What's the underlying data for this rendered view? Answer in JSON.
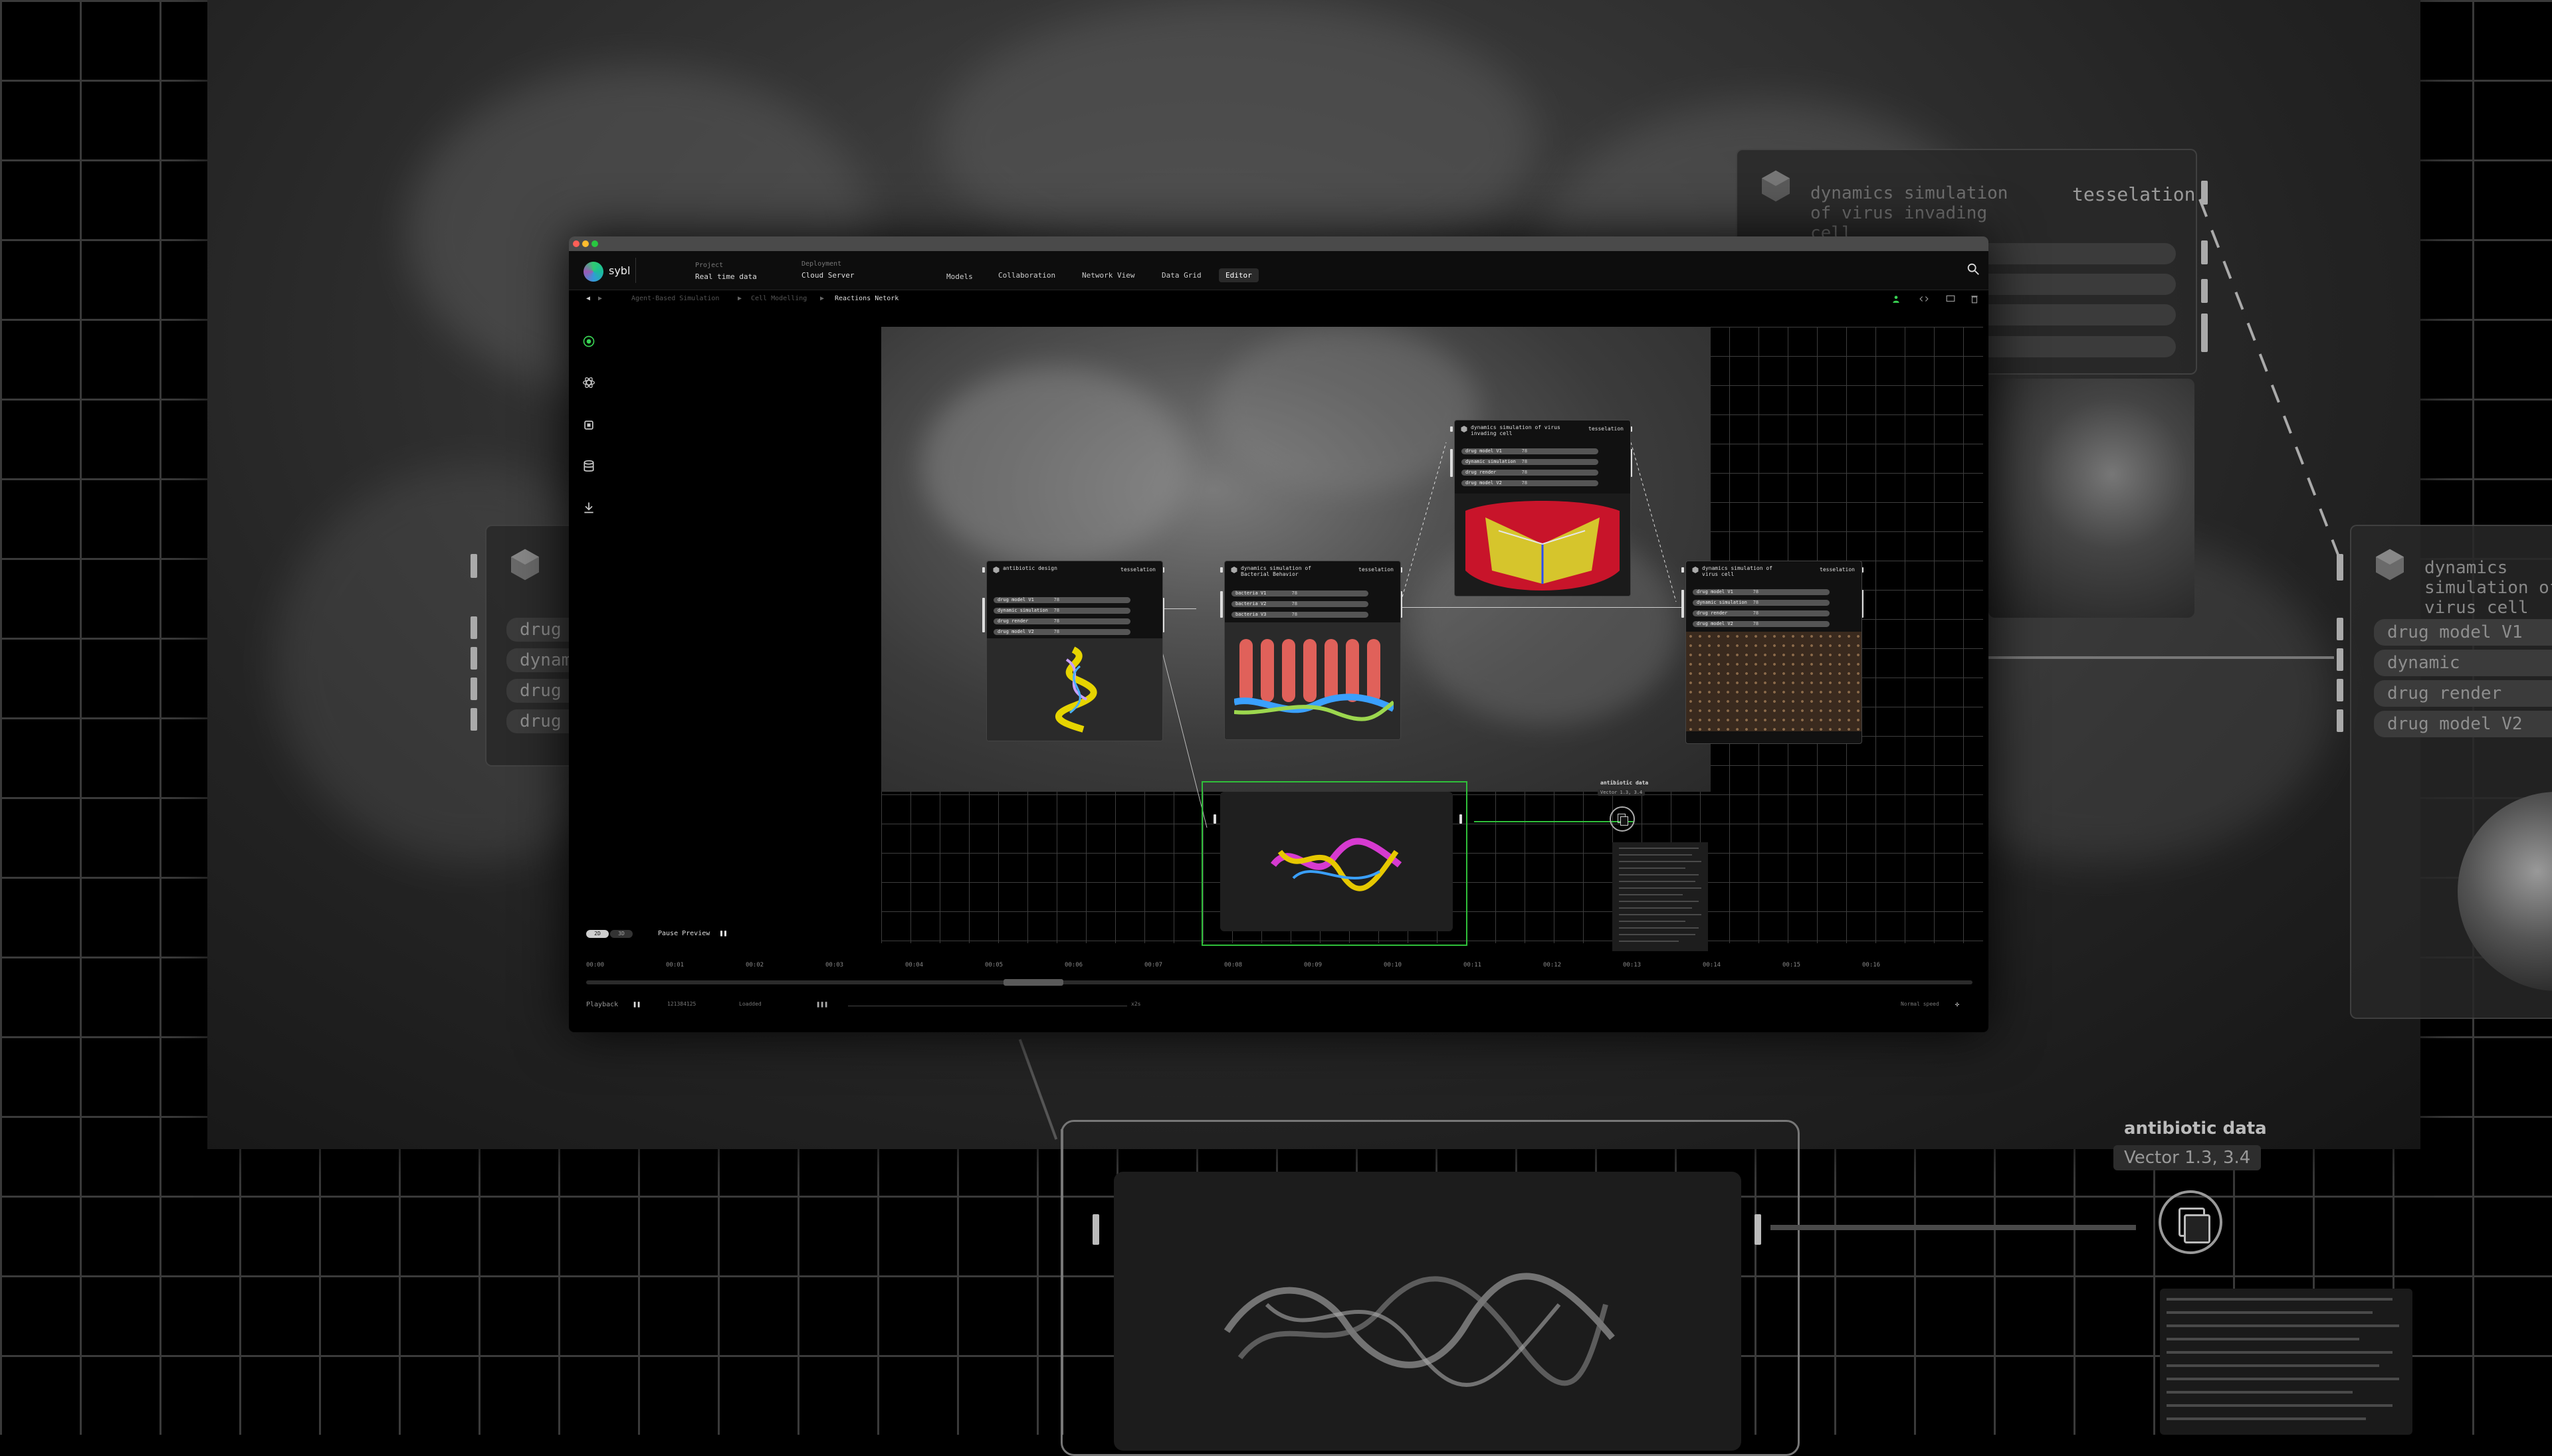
{
  "window": {
    "brand": "sybl",
    "project_key": "Project",
    "project_value": "Real time data",
    "deployment_key": "Deployment",
    "deployment_value": "Cloud Server",
    "nav": [
      "Models",
      "Collaboration",
      "Network View",
      "Data Grid",
      "Editor"
    ],
    "active_nav": "Editor"
  },
  "breadcrumb": [
    "Agent-Based Simulation",
    "Cell Modelling",
    "Reactions Netork"
  ],
  "sidebar_icons": [
    "target-icon",
    "atom-icon",
    "chip-icon",
    "database-icon",
    "download-icon"
  ],
  "nodes": {
    "antibiotic": {
      "title": "antibiotic design",
      "tag": "tesselation",
      "rows": [
        {
          "label": "drug model V1",
          "pct": "78"
        },
        {
          "label": "dynamic simulation",
          "pct": "78"
        },
        {
          "label": "drug render",
          "pct": "78"
        },
        {
          "label": "drug model V2",
          "pct": "78"
        }
      ]
    },
    "bacterial": {
      "title": "dynamics simulation of Bacterial Behavior",
      "tag": "tesselation",
      "rows": [
        {
          "label": "bacteria V1",
          "pct": "78"
        },
        {
          "label": "bacteria V2",
          "pct": "78"
        },
        {
          "label": "bacteria V3",
          "pct": "78"
        }
      ]
    },
    "virus_invading": {
      "title": "dynamics simulation of virus invading cell",
      "tag": "tesselation",
      "rows": [
        {
          "label": "drug model V1",
          "pct": "78"
        },
        {
          "label": "dynamic simulation",
          "pct": "78"
        },
        {
          "label": "drug render",
          "pct": "78"
        },
        {
          "label": "drug model V2",
          "pct": "78"
        }
      ]
    },
    "virus_cell": {
      "title": "dynamics simulation of virus cell",
      "tag": "tesselation",
      "rows": [
        {
          "label": "drug model V1",
          "pct": "78"
        },
        {
          "label": "dynamic simulation",
          "pct": "78"
        },
        {
          "label": "drug render",
          "pct": "78"
        },
        {
          "label": "drug model V2",
          "pct": "78"
        }
      ]
    }
  },
  "data_badge": {
    "title": "antibiotic data",
    "subtitle": "Vector 1.3, 3.4"
  },
  "bottom": {
    "toggle_2d": "2D",
    "toggle_3d": "3D",
    "pause_preview": "Pause Preview",
    "timeline_ticks": [
      "00:00",
      "00:01",
      "00:02",
      "00:03",
      "00:04",
      "00:05",
      "00:06",
      "00:07",
      "00:08",
      "00:09",
      "00:10",
      "00:11",
      "00:12",
      "00:13",
      "00:14",
      "00:15",
      "00:16"
    ],
    "playback_label": "Playback",
    "playback_id": "121384125",
    "playback_status": "Loadded",
    "speed_value": "x2s",
    "speed_label": "Normal speed"
  },
  "background": {
    "top_card_title": "dynamics simulation of virus invading cell",
    "top_card_tag": "tesselation",
    "right_card_title": "dynamics simulation of virus cell",
    "right_card_rows": [
      "drug model V1",
      "dynamic simulation",
      "drug render",
      "drug model V2"
    ],
    "left_card_rows": [
      "drug",
      "dynam",
      "drug",
      "drug"
    ],
    "badge_title": "antibiotic data",
    "badge_subtitle": "Vector 1.3, 3.4"
  },
  "colors": {
    "accent_green": "#39d353",
    "frame_green": "#2fbf3a"
  }
}
